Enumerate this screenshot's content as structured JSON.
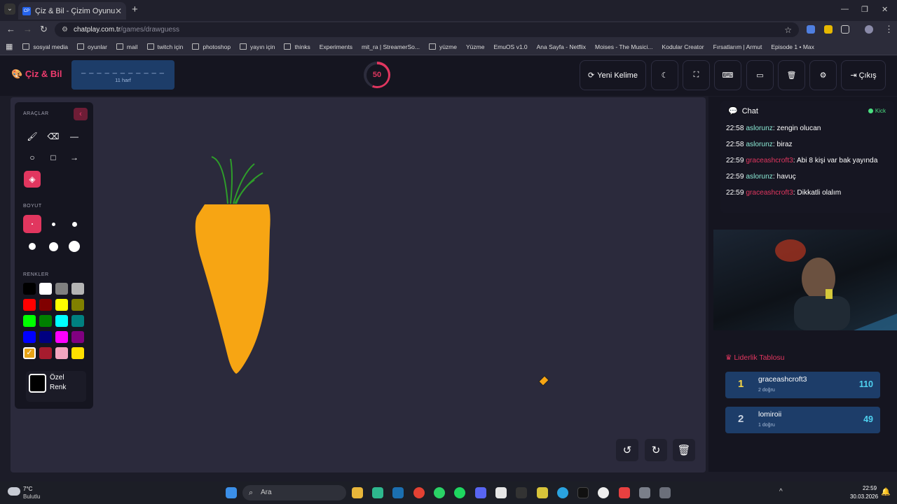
{
  "browser": {
    "tab_title": "Çiz & Bil - Çizim Oyunu",
    "tab_favicon_text": "CP",
    "url_host": "chatplay.com.tr",
    "url_path": "/games/drawguess",
    "bookmarks": [
      "sosyal media",
      "oyunlar",
      "mail",
      "twitch için",
      "photoshop",
      "yayın için",
      "thinks",
      "Experiments",
      "mit_ra | StreamerSo...",
      "yüzme",
      "Yüzme",
      "EmuOS v1.0",
      "Ana Sayfa - Netflix",
      "Moises - The Musici...",
      "Kodular Creator",
      "Fırsatlarım | Armut",
      "Episode 1 • Max"
    ]
  },
  "header": {
    "brand": "Çiz & Bil",
    "word_hint": "_ _ _ _ _ _ _ _ _ _ _",
    "word_count": "11 harf",
    "timer": "50",
    "timer_fraction": 0.56,
    "new_word_label": "Yeni Kelime",
    "exit_label": "Çıkış"
  },
  "tools": {
    "tools_title": "ARAÇLAR",
    "size_title": "BOYUT",
    "colors_title": "RENKLER",
    "custom_color_line1": "Özel",
    "custom_color_line2": "Renk",
    "palette": [
      "#000000",
      "#ffffff",
      "#808080",
      "#b4b4b4",
      "#ff0000",
      "#800000",
      "#ffff00",
      "#808000",
      "#00ff00",
      "#008000",
      "#00ffff",
      "#008080",
      "#0000ff",
      "#000080",
      "#ff00ff",
      "#800080",
      "#e6a317",
      "#a61c2e",
      "#f4a6c0",
      "#ffe000"
    ],
    "selected_color": "#e6a317"
  },
  "chat": {
    "title": "Chat",
    "platform": "Kick",
    "messages": [
      {
        "time": "22:58",
        "user": "aslorunz",
        "text": "zengin olucan"
      },
      {
        "time": "22:58",
        "user": "aslorunz",
        "text": "biraz"
      },
      {
        "time": "22:59",
        "user": "graceashcroft3",
        "text": "Abi 8 kişi var bak yayında"
      },
      {
        "time": "22:59",
        "user": "aslorunz",
        "text": "havuç"
      },
      {
        "time": "22:59",
        "user": "graceashcroft3",
        "text": "Dikkatli olalım"
      }
    ]
  },
  "leaderboard": {
    "title": "Liderlik Tablosu",
    "rows": [
      {
        "rank": "1",
        "name": "graceashcroft3",
        "sub": "2 doğru",
        "score": "110"
      },
      {
        "rank": "2",
        "name": "lomiroii",
        "sub": "1 doğru",
        "score": "49"
      }
    ]
  },
  "taskbar": {
    "weather_temp": "7°C",
    "weather_desc": "Bulutlu",
    "search_placeholder": "Ara",
    "time": "22:59",
    "date": "30.03.2026"
  }
}
